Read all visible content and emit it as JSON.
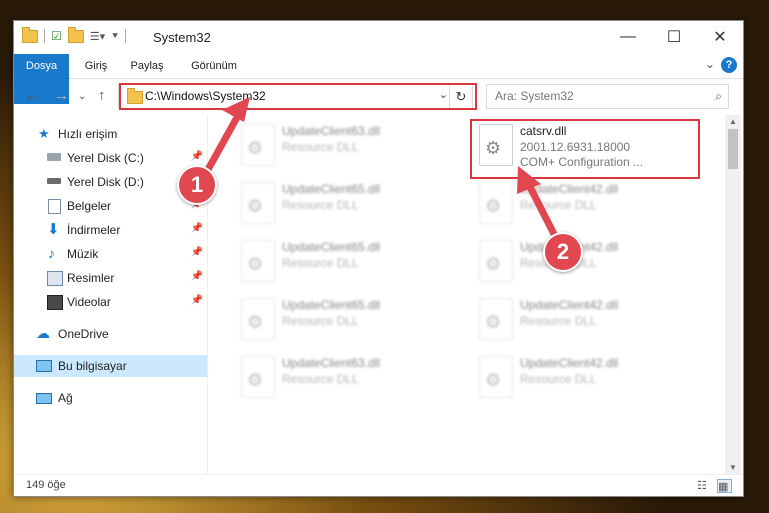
{
  "window": {
    "title": "System32",
    "controls": {
      "minimize": "—",
      "maximize": "☐",
      "close": "✕"
    }
  },
  "ribbon": {
    "tabs": [
      {
        "label": "Dosya"
      },
      {
        "label": "Giriş"
      },
      {
        "label": "Paylaş"
      },
      {
        "label": "Görünüm"
      }
    ],
    "help_label": "?"
  },
  "navigation": {
    "address": "C:\\Windows\\System32",
    "search_placeholder": "Ara: System32"
  },
  "sidebar": {
    "items": [
      {
        "label": "Hızlı erişim",
        "icon": "star-icon"
      },
      {
        "label": "Yerel Disk (C:)",
        "icon": "drive-icon",
        "pinned": true
      },
      {
        "label": "Yerel Disk (D:)",
        "icon": "drive-icon",
        "pinned": false
      },
      {
        "label": "Belgeler",
        "icon": "documents-icon",
        "pinned": true
      },
      {
        "label": "İndirmeler",
        "icon": "download-icon",
        "pinned": true
      },
      {
        "label": "Müzik",
        "icon": "music-icon",
        "pinned": true
      },
      {
        "label": "Resimler",
        "icon": "pictures-icon",
        "pinned": true
      },
      {
        "label": "Videolar",
        "icon": "videos-icon",
        "pinned": true
      },
      {
        "label": "OneDrive",
        "icon": "cloud-icon"
      },
      {
        "label": "Bu bilgisayar",
        "icon": "computer-icon",
        "selected": true
      },
      {
        "label": "Ağ",
        "icon": "network-icon"
      }
    ]
  },
  "files": {
    "left": [
      {
        "name": "UpdateClient63.dll",
        "desc": "Resource DLL"
      },
      {
        "name": "UpdateClient65.dll",
        "desc": "Resource DLL"
      },
      {
        "name": "UpdateClient65.dll",
        "desc": "Resource DLL"
      },
      {
        "name": "UpdateClient65.dll",
        "desc": "Resource DLL"
      },
      {
        "name": "UpdateClient63.dll",
        "desc": "Resource DLL"
      }
    ],
    "right_top": {
      "name": "catsrv.dll",
      "version": "2001.12.6931.18000",
      "desc": "COM+ Configuration ..."
    },
    "right": [
      {
        "name": "UpdateClient42.dll",
        "desc": "Resource DLL"
      },
      {
        "name": "UpdateClient42.dll",
        "desc": "Resource DLL"
      },
      {
        "name": "UpdateClient42.dll",
        "desc": "Resource DLL"
      },
      {
        "name": "UpdateClient42.dll",
        "desc": "Resource DLL"
      }
    ]
  },
  "status": {
    "item_count": "149 öğe"
  },
  "callouts": {
    "first": "1",
    "second": "2"
  },
  "colors": {
    "accent": "#1979ca",
    "annotation": "#d9363e"
  }
}
